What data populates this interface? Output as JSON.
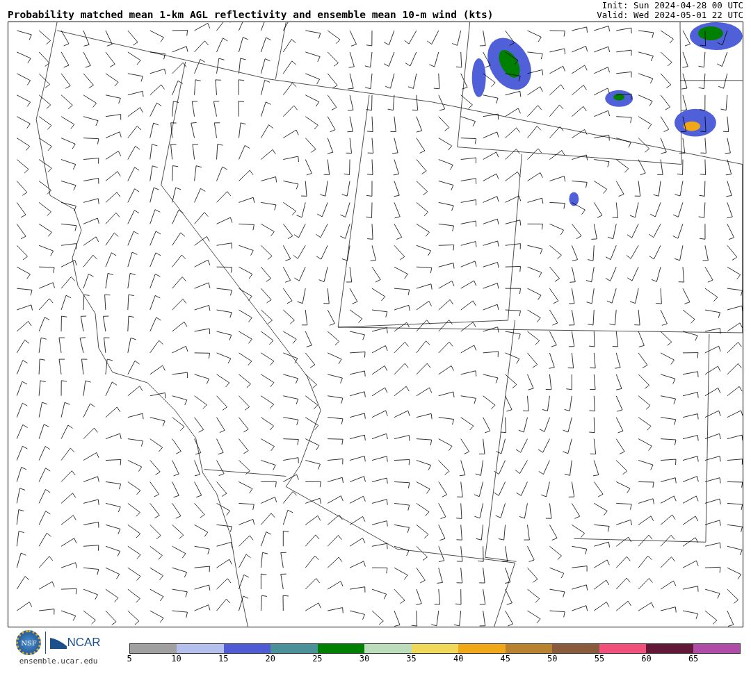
{
  "header": {
    "title": "Probability matched mean 1-km AGL reflectivity and ensemble mean 10-m wind (kts)",
    "init": "Init: Sun 2024-04-28 00 UTC",
    "valid": "Valid: Wed 2024-05-01 22 UTC"
  },
  "footer": {
    "nsf_logo": "NSF",
    "ncar_logo": "NCAR",
    "site": "ensemble.ucar.edu"
  },
  "colorbar": {
    "bins": [
      {
        "color": "#a0a0a0"
      },
      {
        "color": "#b4bfee"
      },
      {
        "color": "#4f5bd5"
      },
      {
        "color": "#4b9199"
      },
      {
        "color": "#008000"
      },
      {
        "color": "#bcddb9"
      },
      {
        "color": "#f0d858"
      },
      {
        "color": "#f0a818"
      },
      {
        "color": "#b8822e"
      },
      {
        "color": "#8a5a3c"
      },
      {
        "color": "#f0507a"
      },
      {
        "color": "#641838"
      },
      {
        "color": "#b04ca8"
      }
    ],
    "ticks": [
      "5",
      "10",
      "15",
      "20",
      "25",
      "30",
      "35",
      "40",
      "45",
      "50",
      "55",
      "60",
      "65"
    ]
  }
}
